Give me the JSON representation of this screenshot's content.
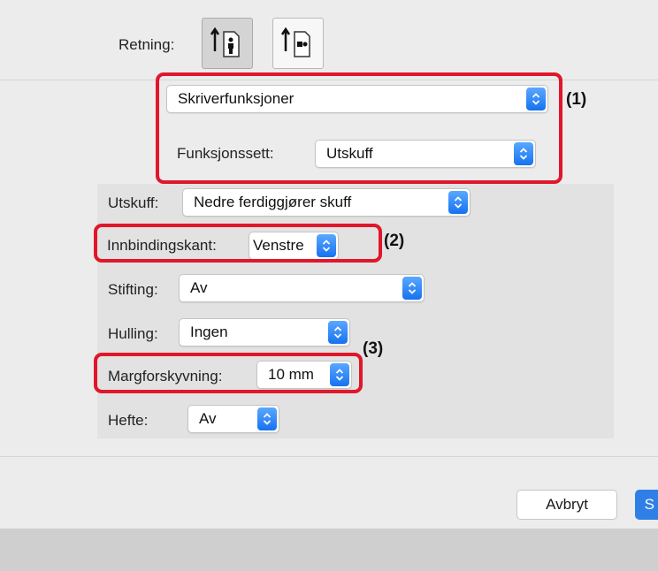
{
  "orientation": {
    "label": "Retning:",
    "options": [
      {
        "name": "portrait",
        "selected": true
      },
      {
        "name": "landscape",
        "selected": false
      }
    ]
  },
  "section_select": {
    "value": "Skriverfunksjoner"
  },
  "feature_set": {
    "label": "Funksjonssett:",
    "value": "Utskuff"
  },
  "fields": {
    "utskuff": {
      "label": "Utskuff:",
      "value": "Nedre ferdiggjører skuff"
    },
    "innbindingskant": {
      "label": "Innbindingskant:",
      "value": "Venstre"
    },
    "stifting": {
      "label": "Stifting:",
      "value": "Av"
    },
    "hulling": {
      "label": "Hulling:",
      "value": "Ingen"
    },
    "margforskyvning": {
      "label": "Margforskyvning:",
      "value": "10 mm"
    },
    "hefte": {
      "label": "Hefte:",
      "value": "Av"
    }
  },
  "callouts": {
    "one": "(1)",
    "two": "(2)",
    "three": "(3)"
  },
  "buttons": {
    "cancel": "Avbryt",
    "save_partial": "S"
  },
  "colors": {
    "highlight": "#e0172a",
    "accent": "#2f7fe6"
  }
}
